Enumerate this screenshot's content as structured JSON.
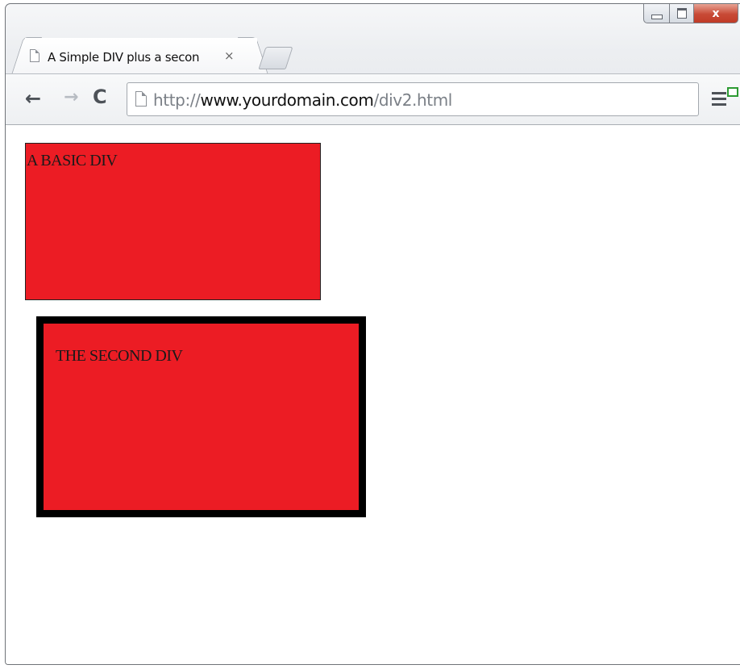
{
  "window": {
    "controls": {
      "minimize": "",
      "maximize": "",
      "close": "x"
    }
  },
  "tab": {
    "title": "A Simple DIV plus a secon",
    "close_glyph": "×"
  },
  "toolbar": {
    "back_glyph": "←",
    "forward_glyph": "→",
    "reload_glyph": "C",
    "url": {
      "scheme": "http://",
      "host": "www.yourdomain.com",
      "path": "/div2.html"
    }
  },
  "page": {
    "basic_div_text": "A BASIC DIV",
    "second_div_text": "THE SECOND DIV",
    "div_fill_color": "#ec1c24",
    "second_div_border_color": "#000000"
  },
  "icons": {
    "tab_favicon": "page-icon",
    "omnibox_icon": "page-icon",
    "menu": "hamburger-menu-icon",
    "update_badge": "update-available-icon"
  }
}
